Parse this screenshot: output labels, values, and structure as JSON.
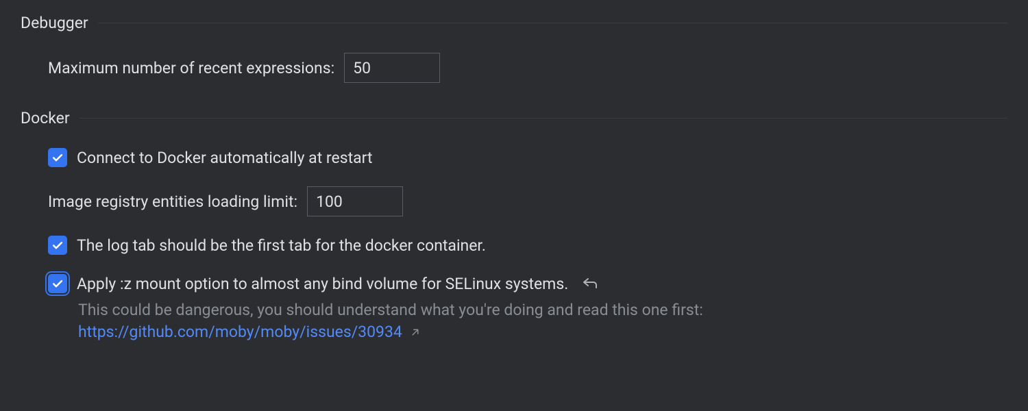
{
  "debugger": {
    "title": "Debugger",
    "max_recent_expressions": {
      "label": "Maximum number of recent expressions:",
      "value": "50"
    }
  },
  "docker": {
    "title": "Docker",
    "connect_auto": {
      "checked": true,
      "label": "Connect to Docker automatically at restart"
    },
    "registry_limit": {
      "label": "Image registry entities loading limit:",
      "value": "100"
    },
    "log_tab_first": {
      "checked": true,
      "label": "The log tab should be the first tab for the docker container."
    },
    "apply_z_mount": {
      "checked": true,
      "focused": true,
      "label": "Apply :z mount option to almost any bind volume for SELinux systems.",
      "hint": "This could be dangerous, you should understand what you're doing and read this one first:",
      "link": "https://github.com/moby/moby/issues/30934"
    }
  }
}
